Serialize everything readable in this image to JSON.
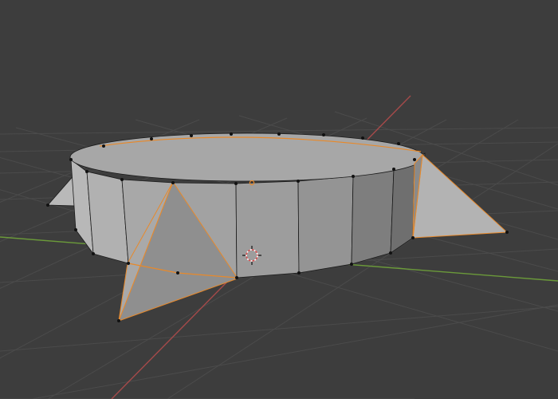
{
  "viewport": {
    "background": "#3d3d3d",
    "grid_color": "#4a4a4a",
    "axis_x_color": "#b04545",
    "axis_y_color": "#6a9a3a",
    "mode": "edit-mode",
    "selection_color": "#e8892a",
    "vertex_color": "#111111"
  },
  "object": {
    "type": "mesh",
    "description_icon": "cylinder-with-spikes",
    "face_light": "#b7b7b7",
    "face_mid": "#9b9b9b",
    "face_dark": "#7a7a7a",
    "face_top": "#a6a6a6"
  },
  "cursor": {
    "icon": "3d-cursor-icon"
  }
}
